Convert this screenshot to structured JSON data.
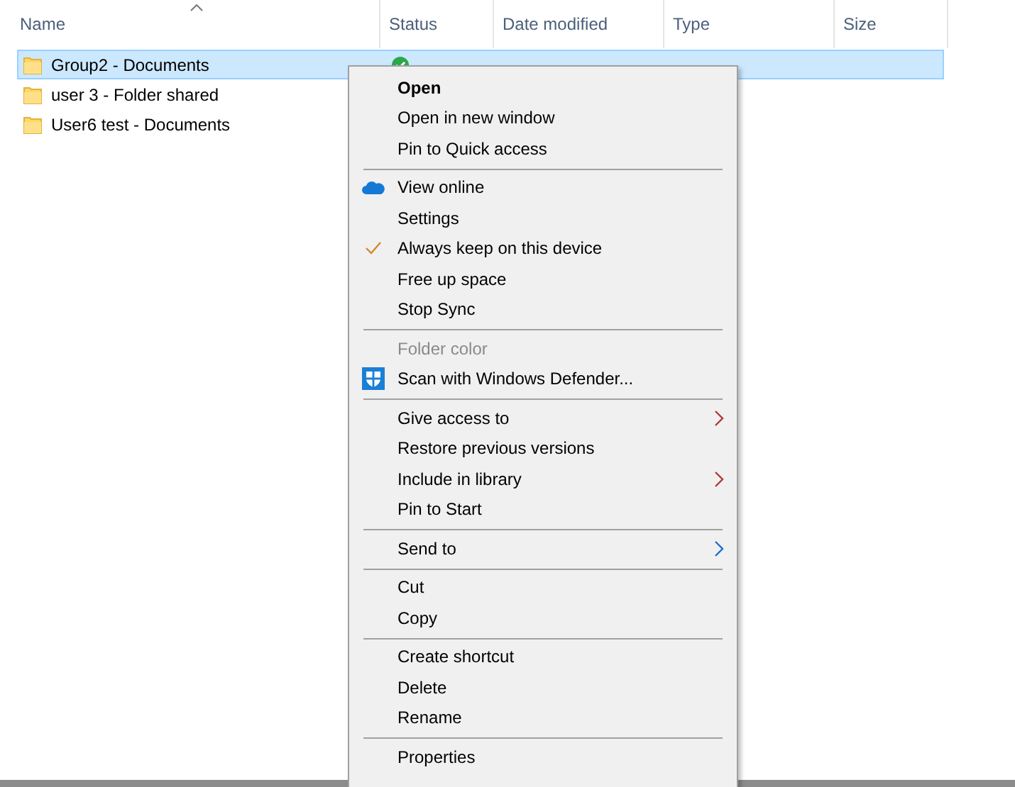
{
  "columns": [
    {
      "label": "Name",
      "sorted": true
    },
    {
      "label": "Status",
      "sorted": false
    },
    {
      "label": "Date modified",
      "sorted": false
    },
    {
      "label": "Type",
      "sorted": false
    },
    {
      "label": "Size",
      "sorted": false
    }
  ],
  "rows": [
    {
      "name": "Group2 - Documents",
      "selected": true,
      "synced": true
    },
    {
      "name": "user 3 - Folder shared",
      "selected": false
    },
    {
      "name": "User6 test - Documents",
      "selected": false
    }
  ],
  "context_menu": [
    {
      "kind": "item",
      "label": "Open",
      "bold": true
    },
    {
      "kind": "item",
      "label": "Open in new window"
    },
    {
      "kind": "item",
      "label": "Pin to Quick access"
    },
    {
      "kind": "separator"
    },
    {
      "kind": "online",
      "label": "View online"
    },
    {
      "kind": "item",
      "label": "Settings"
    },
    {
      "kind": "item",
      "label": "Always keep on this device",
      "checked": true
    },
    {
      "kind": "item",
      "label": "Free up space"
    },
    {
      "kind": "item",
      "label": "Stop Sync"
    },
    {
      "kind": "separator"
    },
    {
      "kind": "item",
      "label": "Folder color",
      "disabled": true
    },
    {
      "kind": "scan",
      "label": "Scan with Windows Defender..."
    },
    {
      "kind": "separator"
    },
    {
      "kind": "item",
      "label": "Give access to",
      "submenu": true
    },
    {
      "kind": "item",
      "label": "Restore previous versions"
    },
    {
      "kind": "item",
      "label": "Include in library",
      "submenu": true
    },
    {
      "kind": "item",
      "label": "Pin to Start"
    },
    {
      "kind": "separator"
    },
    {
      "kind": "item",
      "label": "Send to",
      "submenu": true,
      "color": "#1e6fd0"
    },
    {
      "kind": "separator"
    },
    {
      "kind": "item",
      "label": "Cut"
    },
    {
      "kind": "item",
      "label": "Copy"
    },
    {
      "kind": "separator"
    },
    {
      "kind": "item",
      "label": "Create shortcut"
    },
    {
      "kind": "item",
      "label": "Delete"
    },
    {
      "kind": "item",
      "label": "Rename"
    },
    {
      "kind": "separator"
    },
    {
      "kind": "item",
      "label": "Properties"
    }
  ]
}
